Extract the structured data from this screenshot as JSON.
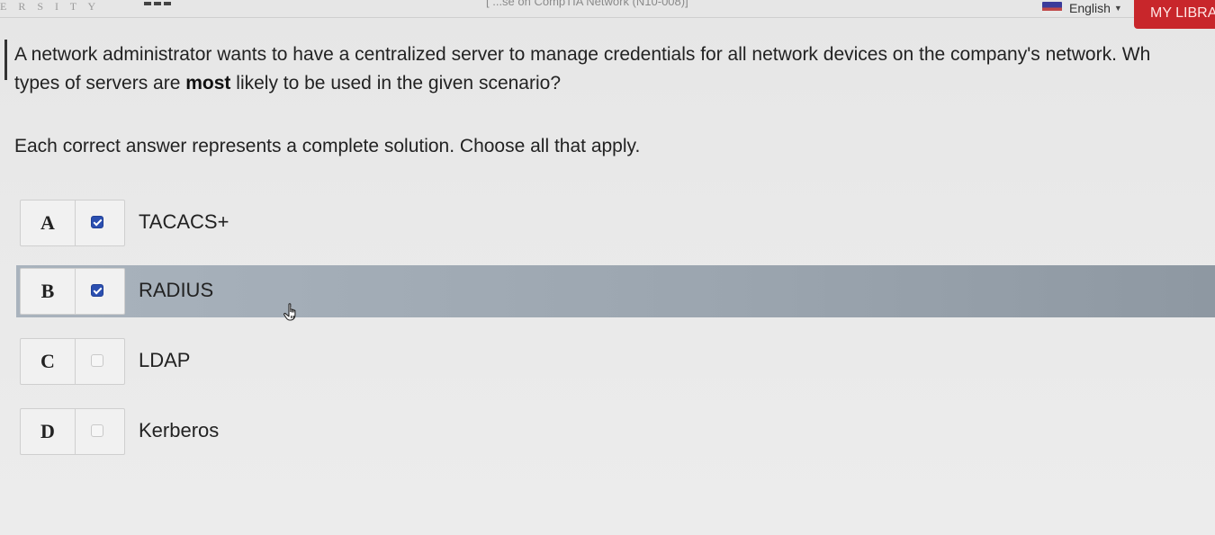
{
  "header": {
    "brand": "E R S I T Y",
    "course_title": "[ ...se on CompTIA Network (N10-008)]",
    "language": "English",
    "library_button": "MY LIBRA"
  },
  "question": {
    "line1": "A network administrator wants to have a centralized server to manage credentials for all network devices on the company's network. Wh",
    "line2_before": "types of servers are ",
    "line2_bold": "most",
    "line2_after": " likely to be used in the given scenario?",
    "instruction": "Each correct answer represents a complete solution. Choose all that apply."
  },
  "options": [
    {
      "letter": "A",
      "text": "TACACS+",
      "checked": true
    },
    {
      "letter": "B",
      "text": "RADIUS",
      "checked": true
    },
    {
      "letter": "C",
      "text": "LDAP",
      "checked": false
    },
    {
      "letter": "D",
      "text": "Kerberos",
      "checked": false
    }
  ],
  "icons": {
    "cursor": "hand-pointer-icon",
    "flag": "flag-icon",
    "caret": "caret-down-icon"
  },
  "colors": {
    "library_button": "#c8262b",
    "checkbox_checked": "#2b4fb0",
    "selected_row": "#9ba5af"
  }
}
